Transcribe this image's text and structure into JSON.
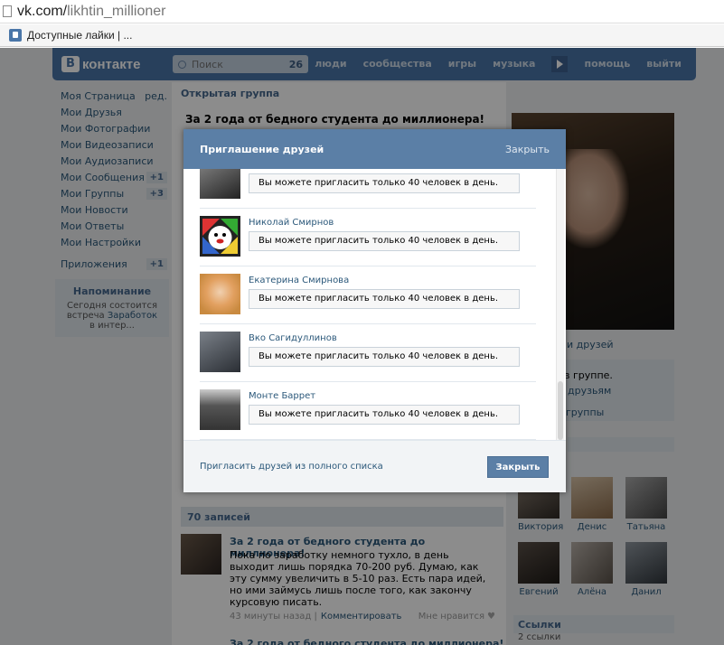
{
  "browser": {
    "url_host": "vk.com/",
    "url_path": "likhtin_millioner",
    "bookmark_label": "Доступные лайки | ..."
  },
  "header": {
    "logo_letter": "В",
    "logo_text": "контакте",
    "search_placeholder": "Поиск",
    "search_count": "26",
    "nav": [
      "люди",
      "сообщества",
      "игры",
      "музыка",
      "помощь",
      "выйти"
    ]
  },
  "left_menu": {
    "items": [
      {
        "label": "Моя Страница",
        "extra": "ред."
      },
      {
        "label": "Мои Друзья",
        "extra": ""
      },
      {
        "label": "Мои Фотографии",
        "extra": ""
      },
      {
        "label": "Мои Видеозаписи",
        "extra": ""
      },
      {
        "label": "Мои Аудиозаписи",
        "extra": ""
      },
      {
        "label": "Мои Сообщения",
        "extra": "+1"
      },
      {
        "label": "Мои Группы",
        "extra": "+3"
      },
      {
        "label": "Мои Новости",
        "extra": ""
      },
      {
        "label": "Мои Ответы",
        "extra": ""
      },
      {
        "label": "Мои Настройки",
        "extra": ""
      }
    ],
    "apps": {
      "label": "Приложения",
      "extra": "+1"
    }
  },
  "reminder": {
    "title": "Напоминание",
    "line1": "Сегодня состоится",
    "line2_prefix": "встреча ",
    "line2_link": "Заработок",
    "line3": "в интер..."
  },
  "group": {
    "type": "Открытая группа",
    "title": "За 2 года от бедного студента до миллионера!"
  },
  "right": {
    "frag_friends": "и друзей",
    "frag_group": "в группе.",
    "frag_tofriends": "друзьям",
    "frag_groups": "группы"
  },
  "friends": [
    {
      "name": "Виктория"
    },
    {
      "name": "Денис"
    },
    {
      "name": "Татьяна"
    },
    {
      "name": "Евгений"
    },
    {
      "name": "Алёна"
    },
    {
      "name": "Данил"
    }
  ],
  "links": {
    "title": "Ссылки",
    "count": "2 ссылки"
  },
  "posts": {
    "count_label": "70 записей",
    "post1": {
      "title": "За 2 года от бедного студента до миллионера!",
      "text": "Пока по заработку немного тухло, в день выходит лишь порядка 70-200 руб. Думаю, как эту сумму увеличить в 5-10 раз. Есть пара идей, но ими займусь лишь после того, как закончу курсовую писать.",
      "time": "43 минуты назад",
      "comment": "Комментировать",
      "like": "Мне нравится"
    },
    "post2_title": "За 2 года от бедного студента до миллионера!"
  },
  "modal": {
    "title": "Приглашение друзей",
    "close_link": "Закрыть",
    "limit_msg": "Вы можете пригласить только 40 человек в день.",
    "people": [
      {
        "name": ""
      },
      {
        "name": "Николай Смирнов"
      },
      {
        "name": "Екатерина Смирнова"
      },
      {
        "name": "Вко Сагидуллинов"
      },
      {
        "name": "Монте Баррет"
      }
    ],
    "invite_all": "Пригласить друзей из полного списка",
    "close_button": "Закрыть"
  }
}
